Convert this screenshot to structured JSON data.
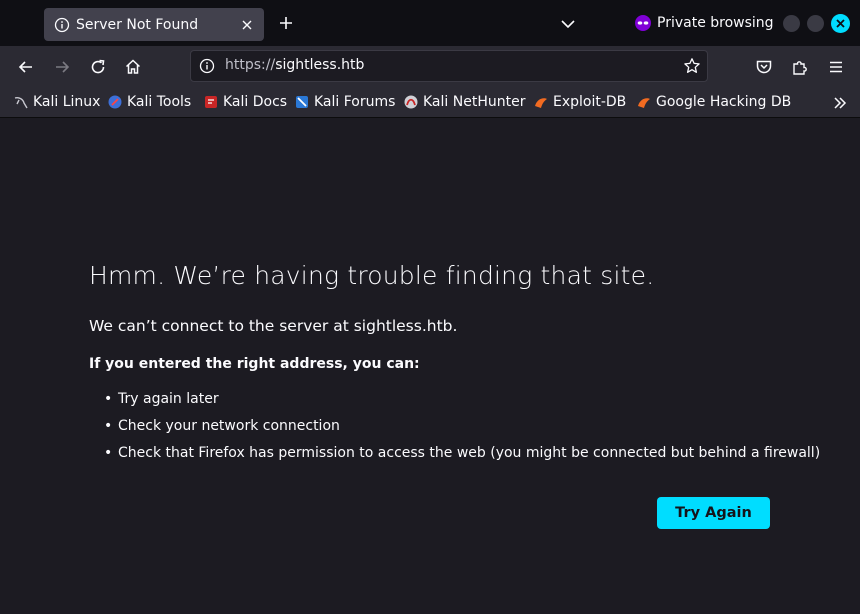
{
  "tab": {
    "title": "Server Not Found"
  },
  "private_label": "Private browsing",
  "navbar": {
    "url_scheme": "https://",
    "url_host": "sightless.htb"
  },
  "bookmarks": [
    {
      "label": "Kali Linux",
      "icon": "kali-dragon-icon"
    },
    {
      "label": "Kali Tools",
      "icon": "kali-tools-icon"
    },
    {
      "label": "Kali Docs",
      "icon": "kali-docs-icon"
    },
    {
      "label": "Kali Forums",
      "icon": "kali-forums-icon"
    },
    {
      "label": "Kali NetHunter",
      "icon": "kali-nethunter-icon"
    },
    {
      "label": "Exploit-DB",
      "icon": "exploit-db-icon"
    },
    {
      "label": "Google Hacking DB",
      "icon": "ghdb-icon"
    }
  ],
  "error": {
    "title": "Hmm. We’re having trouble finding that site.",
    "description": "We can’t connect to the server at sightless.htb.",
    "hint": "If you entered the right address, you can:",
    "suggestions": [
      "Try again later",
      "Check your network connection",
      "Check that Firefox has permission to access the web (you might be connected but behind a firewall)"
    ],
    "button": "Try Again"
  },
  "colors": {
    "accent": "#00ddff",
    "page_bg": "#1c1b22",
    "toolbar_bg": "#2b2a33"
  }
}
